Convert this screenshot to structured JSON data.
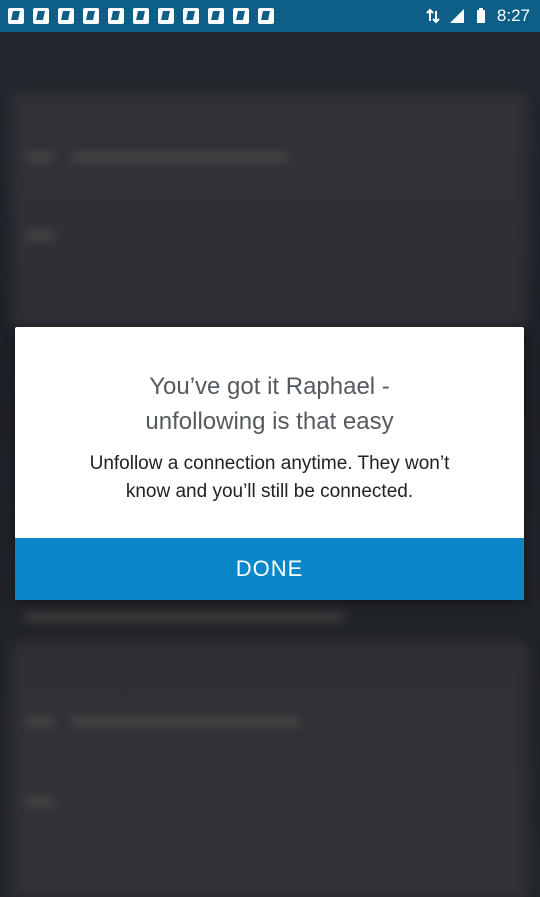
{
  "status_bar": {
    "time": "8:27",
    "notification_icons": [
      "linkedin-icon",
      "linkedin-icon",
      "linkedin-icon",
      "linkedin-icon",
      "linkedin-icon",
      "linkedin-icon",
      "linkedin-icon",
      "linkedin-icon",
      "linkedin-icon",
      "linkedin-icon",
      "linkedin-icon"
    ],
    "system_icons": [
      "data-arrows-icon",
      "signal-icon",
      "battery-icon"
    ],
    "color": "#0d5f88"
  },
  "dialog": {
    "title_line1": "You’ve got it Raphael -",
    "title_line2": "unfollowing is that easy",
    "body_line1": "Unfollow a connection anytime. They won’t",
    "body_line2": "know and you’ll still be connected.",
    "done_label": "DONE",
    "accent_color": "#0a87c9"
  }
}
